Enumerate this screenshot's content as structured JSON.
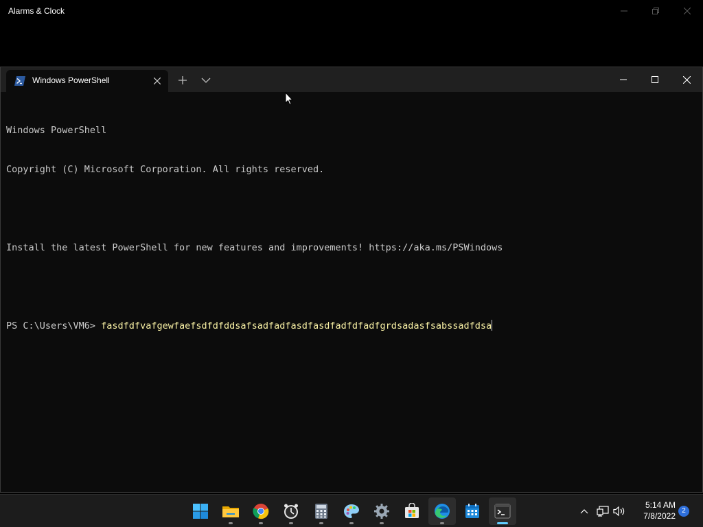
{
  "background_window": {
    "title": "Alarms & Clock"
  },
  "terminal": {
    "tab": {
      "label": "Windows PowerShell",
      "icon": "powershell-icon"
    },
    "new_tab_icon": "plus-icon",
    "dropdown_icon": "chevron-down-icon",
    "console_lines": [
      "Windows PowerShell",
      "Copyright (C) Microsoft Corporation. All rights reserved.",
      "",
      "Install the latest PowerShell for new features and improvements! https://aka.ms/PSWindows",
      ""
    ],
    "prompt": "PS C:\\Users\\VM6> ",
    "command": "fasdfdfvafgewfaefsdfdfddsafsadfadfasdfasdfadfdfadfgrdsadasfsabssadfdsa"
  },
  "taskbar": {
    "apps": [
      {
        "name": "start-icon"
      },
      {
        "name": "file-explorer-icon"
      },
      {
        "name": "chrome-icon"
      },
      {
        "name": "alarms-clock-icon"
      },
      {
        "name": "calculator-icon"
      },
      {
        "name": "paint-icon"
      },
      {
        "name": "settings-icon"
      },
      {
        "name": "microsoft-store-icon"
      },
      {
        "name": "edge-icon"
      },
      {
        "name": "calendar-icon"
      },
      {
        "name": "terminal-icon"
      }
    ],
    "clock_time": "5:14 AM",
    "clock_date": "7/8/2022",
    "notification_count": "2"
  },
  "colors": {
    "console_bg": "#0c0c0c",
    "console_text": "#cccccc",
    "command_text": "#f9f1a5",
    "tabbar_bg": "#202020",
    "taskbar_bg": "#1c1c1c",
    "accent": "#60cdff"
  }
}
